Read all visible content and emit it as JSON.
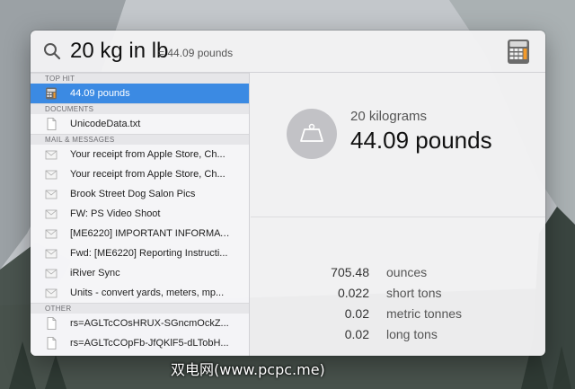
{
  "search": {
    "query": "20 kg in lb",
    "inline_answer": "= 44.09 pounds"
  },
  "sections": [
    {
      "header": "TOP HIT",
      "items": [
        {
          "label": "44.09 pounds",
          "icon": "calculator-icon",
          "selected": true
        }
      ]
    },
    {
      "header": "DOCUMENTS",
      "items": [
        {
          "label": "UnicodeData.txt",
          "icon": "document-icon"
        }
      ]
    },
    {
      "header": "MAIL & MESSAGES",
      "items": [
        {
          "label": "Your receipt from Apple Store, Ch...",
          "icon": "mail-icon"
        },
        {
          "label": "Your receipt from Apple Store, Ch...",
          "icon": "mail-icon"
        },
        {
          "label": "Brook Street Dog Salon Pics",
          "icon": "mail-icon"
        },
        {
          "label": "FW: PS Video Shoot",
          "icon": "mail-icon"
        },
        {
          "label": "[ME6220] IMPORTANT INFORMAT...",
          "icon": "mail-icon"
        },
        {
          "label": "Fwd: [ME6220] Reporting Instructi...",
          "icon": "mail-icon"
        },
        {
          "label": "iRiver Sync",
          "icon": "mail-icon"
        },
        {
          "label": "Units - convert yards, meters, mp...",
          "icon": "mail-icon"
        }
      ]
    },
    {
      "header": "OTHER",
      "items": [
        {
          "label": "rs=AGLTcCOsHRUX-SGncmOckZ...",
          "icon": "document-icon"
        },
        {
          "label": "rs=AGLTcCOpFb-JfQKlF5-dLTobH...",
          "icon": "document-icon"
        }
      ]
    }
  ],
  "preview": {
    "from": "20 kilograms",
    "to": "44.09 pounds",
    "icon": "scale-icon",
    "conversions": [
      {
        "value": "705.48",
        "unit": "ounces"
      },
      {
        "value": "0.022",
        "unit": "short tons"
      },
      {
        "value": "0.02",
        "unit": "metric tonnes"
      },
      {
        "value": "0.02",
        "unit": "long tons"
      }
    ]
  },
  "watermark": "双电网(www.pcpc.me)",
  "colors": {
    "selection": "#3b8ae3",
    "panel": "#f2f2f4"
  }
}
